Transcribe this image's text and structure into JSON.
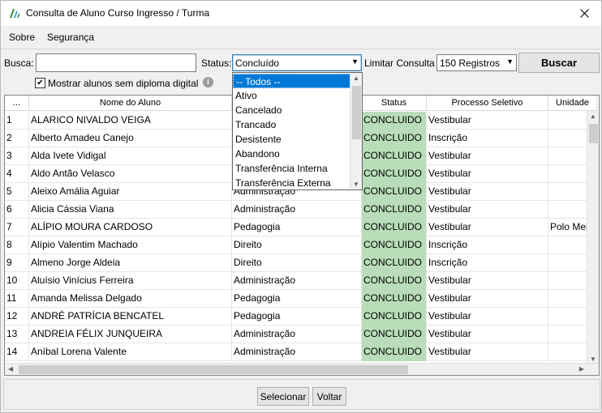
{
  "window": {
    "title": "Consulta de Aluno Curso Ingresso / Turma"
  },
  "menu": {
    "items": [
      "Sobre",
      "Segurança"
    ]
  },
  "filters": {
    "busca_label": "Busca:",
    "busca_value": "",
    "status_label": "Status:",
    "status_value": "Concluído",
    "limit_label": "Limitar Consulta",
    "limit_value": "150 Registros",
    "buscar_label": "Buscar",
    "checkbox_label": "Mostrar alunos sem diploma digital",
    "checkbox_checked": true
  },
  "status_dropdown": {
    "options": [
      "-- Todos --",
      "Ativo",
      "Cancelado",
      "Trancado",
      "Desistente",
      "Abandono",
      "Transferência Interna",
      "Transferência Externa"
    ],
    "selected_index": 0
  },
  "table": {
    "columns": [
      "...",
      "Nome do Aluno",
      "",
      "Status",
      "Processo Seletivo",
      "Unidade"
    ],
    "rows": [
      [
        "1",
        "ALARICO NIVALDO VEIGA",
        "",
        "CONCLUIDO",
        "Vestibular",
        ""
      ],
      [
        "2",
        "Alberto Amadeu Canejo",
        "",
        "CONCLUIDO",
        "Inscrição",
        ""
      ],
      [
        "3",
        "Alda Ivete Vidigal",
        "",
        "CONCLUIDO",
        "Vestibular",
        ""
      ],
      [
        "4",
        "Aldo Antão Velasco",
        "",
        "CONCLUIDO",
        "Vestibular",
        ""
      ],
      [
        "5",
        "Aleixo Amália Aguiar",
        "Administração",
        "CONCLUIDO",
        "Vestibular",
        ""
      ],
      [
        "6",
        "Alicia Cássia Viana",
        "Administração",
        "CONCLUIDO",
        "Vestibular",
        ""
      ],
      [
        "7",
        "ALÍPIO MOURA CARDOSO",
        "Pedagogia",
        "CONCLUIDO",
        "Vestibular",
        "Polo Mei"
      ],
      [
        "8",
        "Alípio Valentim Machado",
        "Direito",
        "CONCLUIDO",
        "Inscrição",
        ""
      ],
      [
        "9",
        "Almeno Jorge Aldeia",
        "Direito",
        "CONCLUIDO",
        "Inscrição",
        ""
      ],
      [
        "10",
        "Aluísio Vinícius Ferreira",
        "Administração",
        "CONCLUIDO",
        "Vestibular",
        ""
      ],
      [
        "11",
        "Amanda Melissa Delgado",
        "Pedagogia",
        "CONCLUIDO",
        "Vestibular",
        ""
      ],
      [
        "12",
        "ANDRÉ PATRÍCIA BENCATEL",
        "Pedagogia",
        "CONCLUIDO",
        "Vestibular",
        ""
      ],
      [
        "13",
        "ANDREIA FÉLIX JUNQUEIRA",
        "Administração",
        "CONCLUIDO",
        "Vestibular",
        ""
      ],
      [
        "14",
        "Aníbal Lorena Valente",
        "Administração",
        "CONCLUIDO",
        "Vestibular",
        ""
      ]
    ]
  },
  "footer": {
    "selecionar_label": "Selecionar",
    "voltar_label": "Voltar"
  },
  "colors": {
    "status_green": "#b8ddb8",
    "selection_blue": "#0078d7"
  }
}
